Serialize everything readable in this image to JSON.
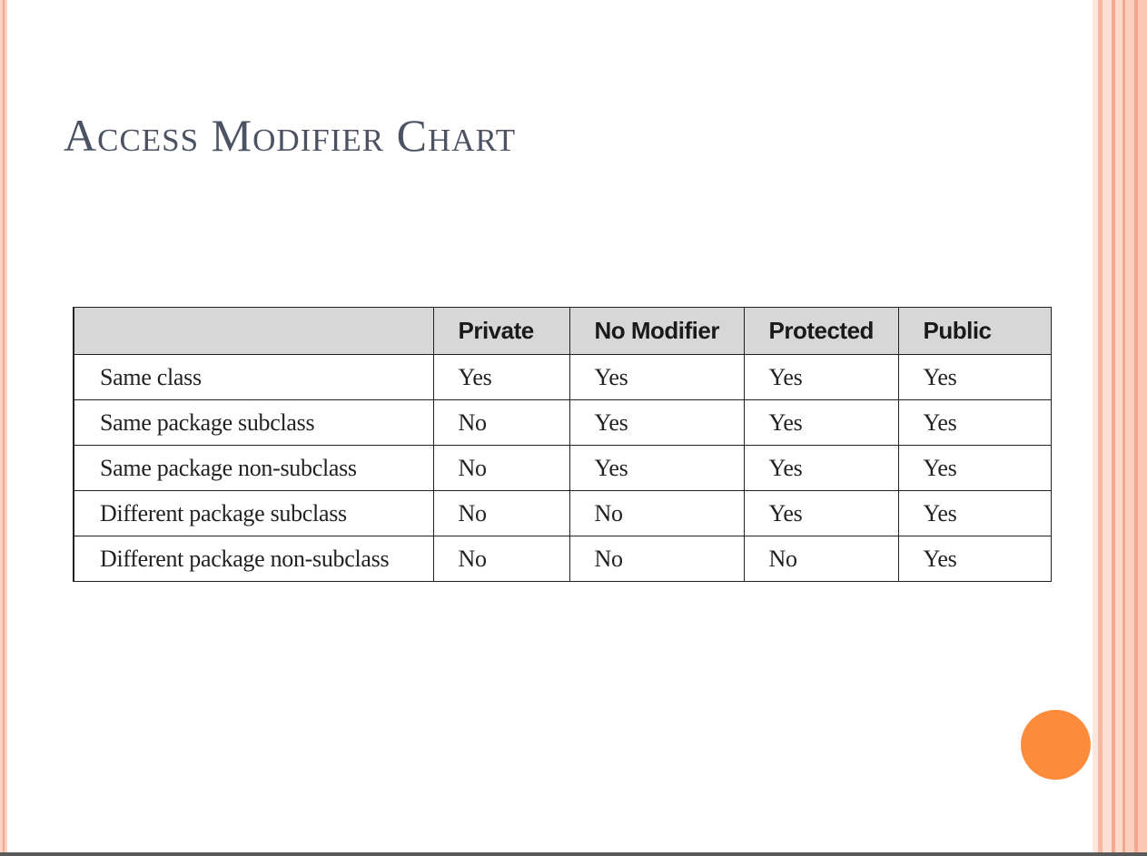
{
  "slide": {
    "title": "Access Modifier Chart"
  },
  "table": {
    "headers": [
      "",
      "Private",
      "No Modifier",
      "Protected",
      "Public"
    ],
    "rows": [
      {
        "label": "Same class",
        "values": [
          "Yes",
          "Yes",
          "Yes",
          "Yes"
        ]
      },
      {
        "label": "Same package subclass",
        "values": [
          "No",
          "Yes",
          "Yes",
          "Yes"
        ]
      },
      {
        "label": "Same package non-subclass",
        "values": [
          "No",
          "Yes",
          "Yes",
          "Yes"
        ]
      },
      {
        "label": "Different package subclass",
        "values": [
          "No",
          "No",
          "Yes",
          "Yes"
        ]
      },
      {
        "label": "Different package non-subclass",
        "values": [
          "No",
          "No",
          "No",
          "Yes"
        ]
      }
    ]
  },
  "theme": {
    "title_color": "#4b5363",
    "header_bg": "#d7d7d7",
    "accent_orange": "#fd8b3c",
    "border_peach": "#fbd3c3"
  }
}
